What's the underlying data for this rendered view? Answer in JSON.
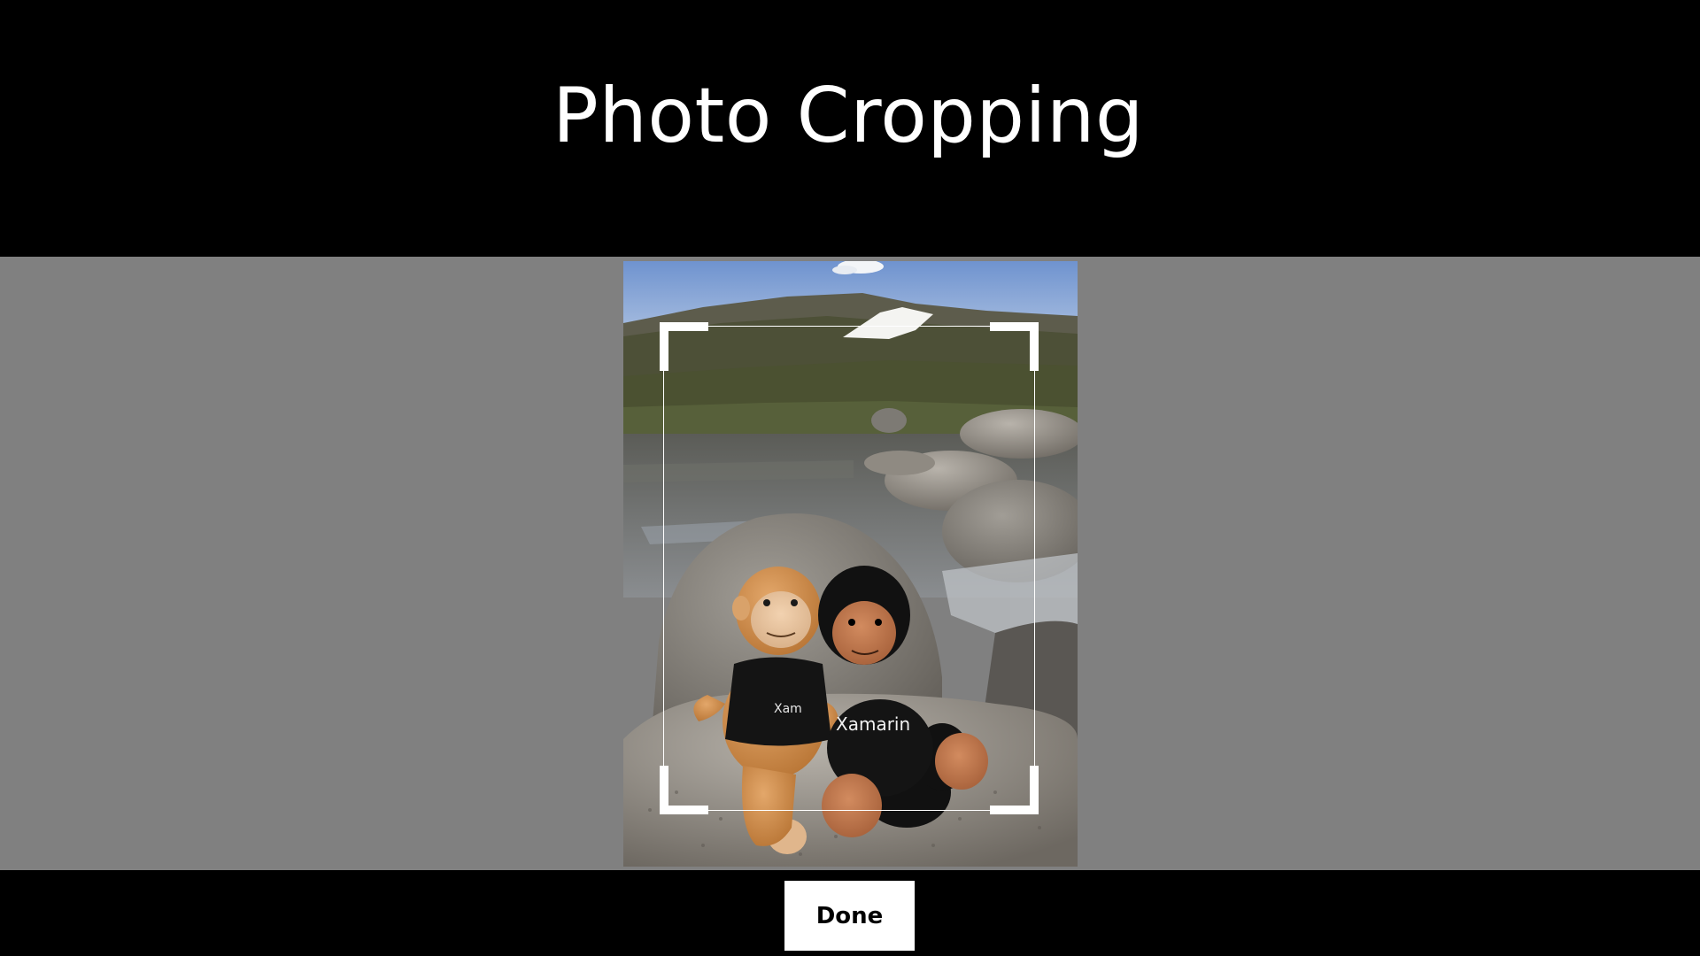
{
  "header": {
    "title": "Photo Cropping"
  },
  "photo": {
    "description_icon": "photo-image",
    "shirt_text": "Xamarin"
  },
  "footer": {
    "done_label": "Done"
  },
  "colors": {
    "bar": "#000000",
    "workspace": "#808080",
    "crop_frame": "#ffffff",
    "button_bg": "#ffffff"
  }
}
